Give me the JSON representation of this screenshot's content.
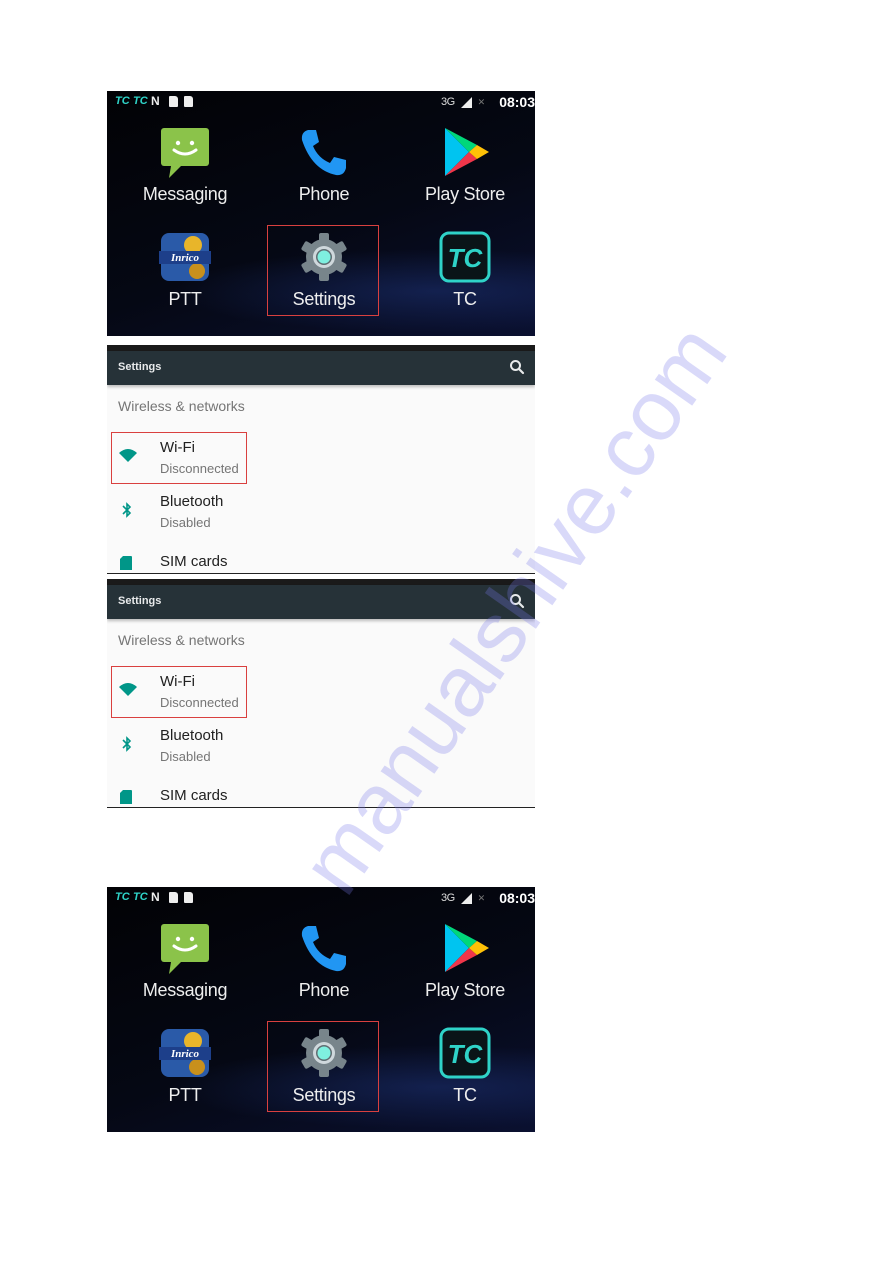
{
  "home_screens": [
    {
      "status_bar": {
        "left_icons": [
          "tc-notification-icon",
          "tc-notification-icon",
          "nfc-icon",
          "sim-card-icon",
          "sd-card-icon"
        ],
        "network": "3G",
        "time": "08:03"
      },
      "apps": [
        {
          "label": "Messaging",
          "icon": "messaging-icon"
        },
        {
          "label": "Phone",
          "icon": "phone-icon"
        },
        {
          "label": "Play Store",
          "icon": "play-store-icon"
        },
        {
          "label": "PTT",
          "icon": "inrico-ptt-icon",
          "icon_text": "Inrico"
        },
        {
          "label": "Settings",
          "icon": "settings-gear-icon",
          "highlighted": true
        },
        {
          "label": "TC",
          "icon": "tc-app-icon",
          "icon_text": "TC"
        }
      ]
    },
    {
      "status_bar": {
        "left_icons": [
          "tc-notification-icon",
          "tc-notification-icon",
          "nfc-icon",
          "sim-card-icon",
          "sd-card-icon"
        ],
        "network": "3G",
        "time": "08:03"
      },
      "apps": [
        {
          "label": "Messaging",
          "icon": "messaging-icon"
        },
        {
          "label": "Phone",
          "icon": "phone-icon"
        },
        {
          "label": "Play Store",
          "icon": "play-store-icon"
        },
        {
          "label": "PTT",
          "icon": "inrico-ptt-icon",
          "icon_text": "Inrico"
        },
        {
          "label": "Settings",
          "icon": "settings-gear-icon",
          "highlighted": true
        },
        {
          "label": "TC",
          "icon": "tc-app-icon",
          "icon_text": "TC"
        }
      ]
    }
  ],
  "settings_screens": [
    {
      "title": "Settings",
      "section": "Wireless & networks",
      "items": [
        {
          "title": "Wi-Fi",
          "subtitle": "Disconnected",
          "icon": "wifi-icon",
          "highlighted": true
        },
        {
          "title": "Bluetooth",
          "subtitle": "Disabled",
          "icon": "bluetooth-icon"
        },
        {
          "title": "SIM cards",
          "subtitle": "",
          "icon": "sim-card-icon"
        }
      ]
    },
    {
      "title": "Settings",
      "section": "Wireless & networks",
      "items": [
        {
          "title": "Wi-Fi",
          "subtitle": "Disconnected",
          "icon": "wifi-icon",
          "highlighted": true
        },
        {
          "title": "Bluetooth",
          "subtitle": "Disabled",
          "icon": "bluetooth-icon"
        },
        {
          "title": "SIM cards",
          "subtitle": "",
          "icon": "sim-card-icon"
        }
      ]
    }
  ],
  "colors": {
    "highlight_box": "#d9403f",
    "settings_accent": "#009688",
    "toolbar": "#263238",
    "watermark": "#7878eb"
  },
  "watermark": "manualshive.com"
}
